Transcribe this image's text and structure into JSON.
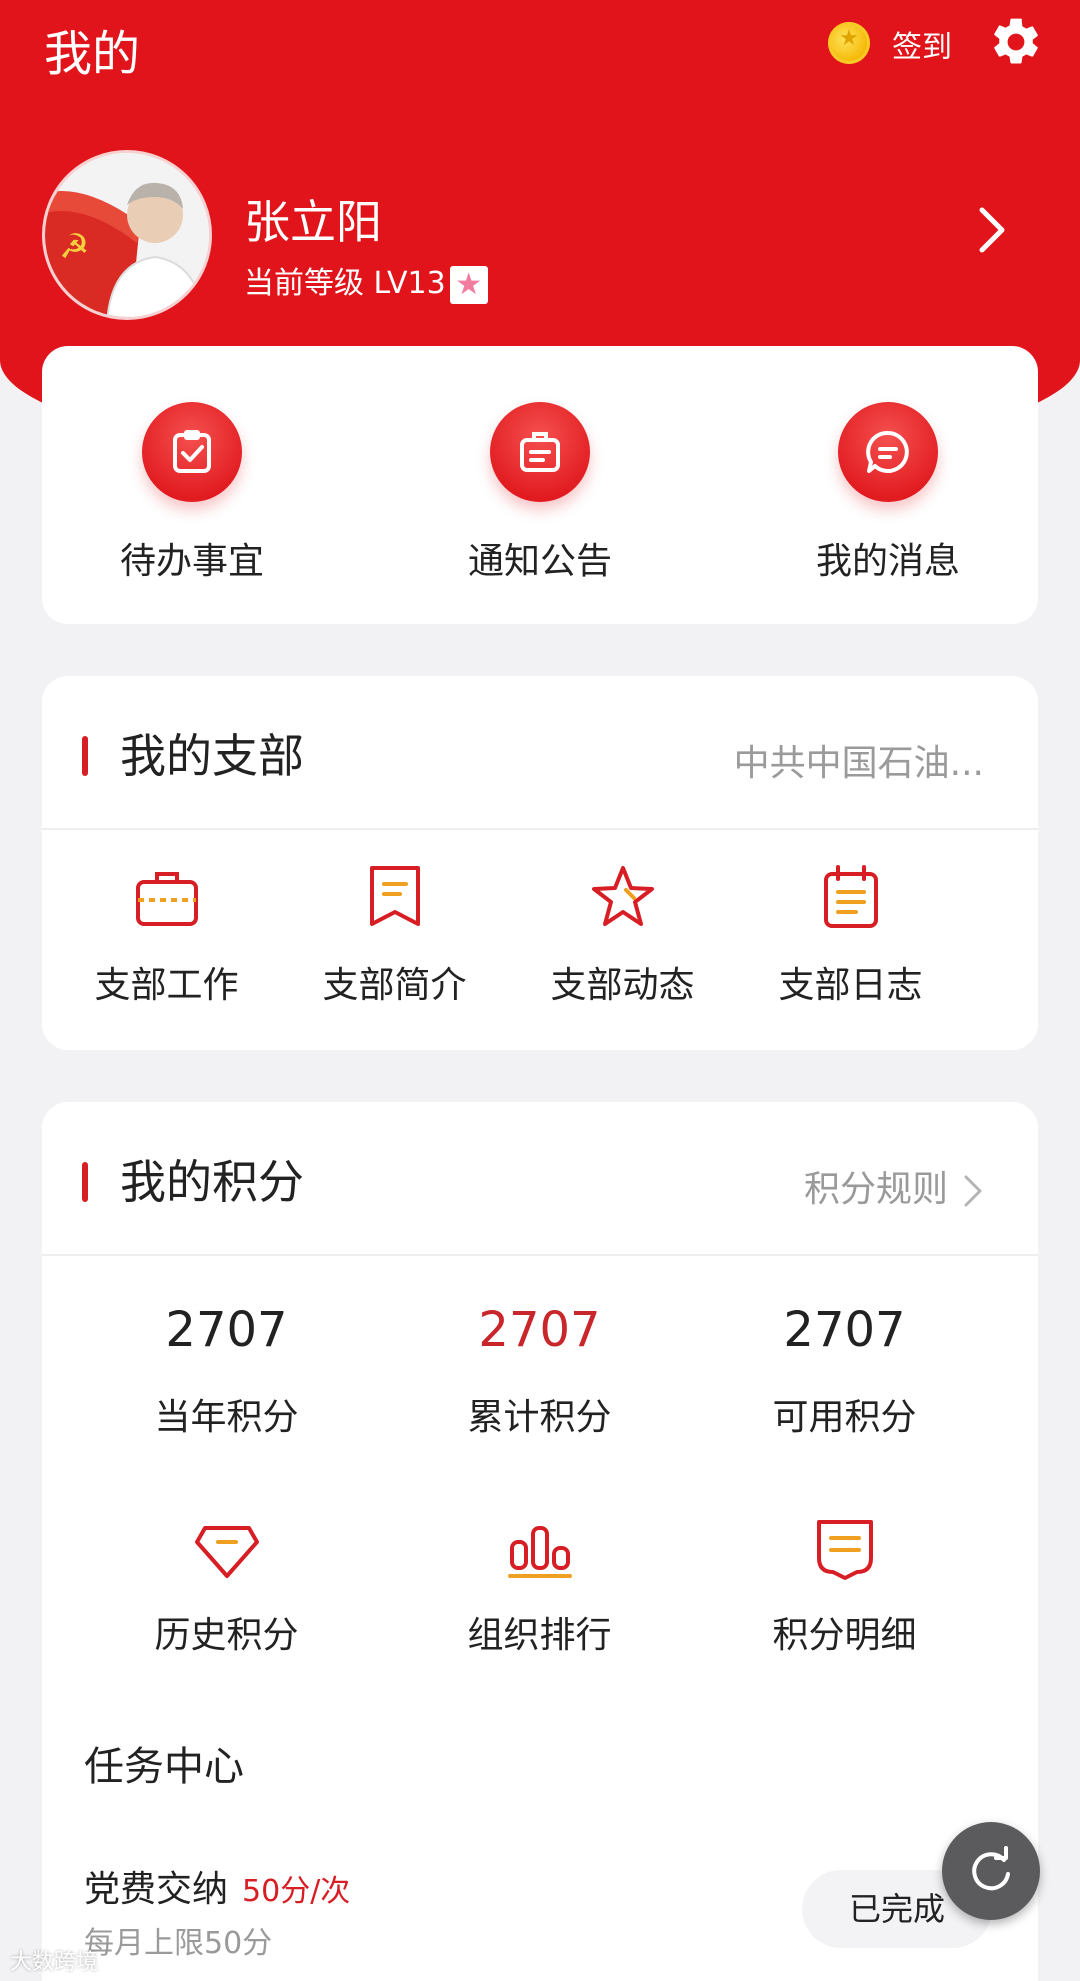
{
  "header": {
    "title": "我的",
    "checkin_label": "签到"
  },
  "profile": {
    "name": "张立阳",
    "level_text": "当前等级 LV13"
  },
  "quick_actions": [
    {
      "label": "待办事宜",
      "icon": "clipboard-check-icon"
    },
    {
      "label": "通知公告",
      "icon": "notice-board-icon"
    },
    {
      "label": "我的消息",
      "icon": "message-bubble-icon"
    }
  ],
  "branch": {
    "title": "我的支部",
    "org_name": "中共中国石油...",
    "items": [
      {
        "label": "支部工作",
        "icon": "briefcase-icon"
      },
      {
        "label": "支部简介",
        "icon": "bookmark-icon"
      },
      {
        "label": "支部动态",
        "icon": "star-icon"
      },
      {
        "label": "支部日志",
        "icon": "calendar-icon"
      }
    ]
  },
  "points": {
    "title": "我的积分",
    "rules_link": "积分规则",
    "stats": [
      {
        "value": "2707",
        "label": "当年积分"
      },
      {
        "value": "2707",
        "label": "累计积分"
      },
      {
        "value": "2707",
        "label": "可用积分"
      }
    ],
    "tools": [
      {
        "label": "历史积分",
        "icon": "diamond-icon"
      },
      {
        "label": "组织排行",
        "icon": "bar-chart-icon"
      },
      {
        "label": "积分明细",
        "icon": "receipt-icon"
      }
    ]
  },
  "tasks": {
    "heading": "任务中心",
    "items": [
      {
        "name": "党费交纳",
        "points": "50分/次",
        "limit": "每月上限50分",
        "status": "已完成"
      }
    ]
  },
  "watermark": "大数跨境",
  "colors": {
    "brand_red": "#e1141b",
    "accent_red": "#d81e25",
    "stat_highlight": "#c8262a",
    "background": "#f2f2f4"
  }
}
